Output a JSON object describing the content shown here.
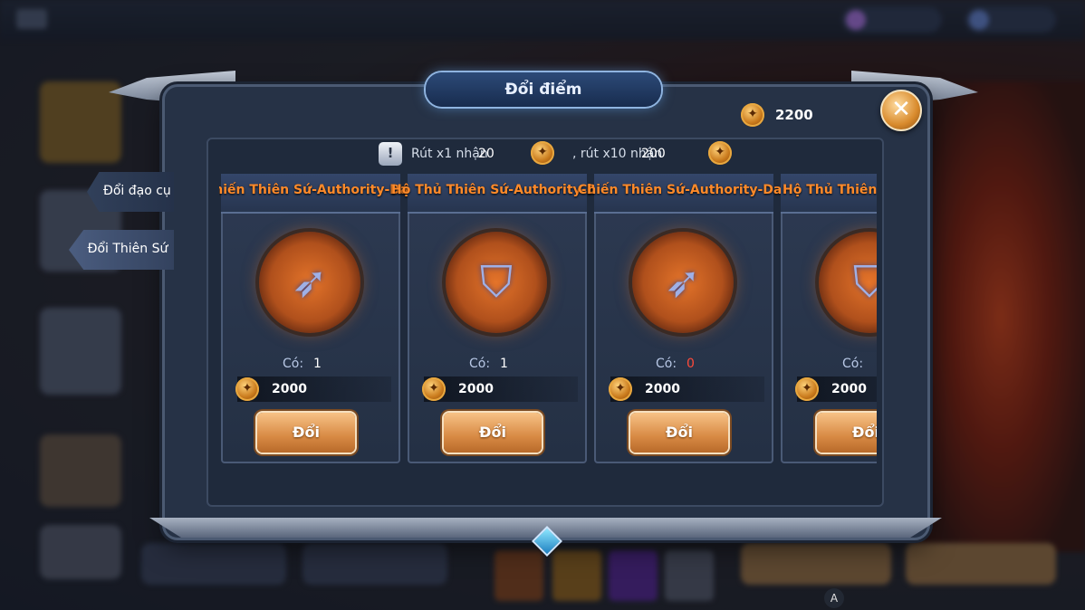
{
  "dialog": {
    "title": "Đổi điểm",
    "balance": "2200",
    "close_icon": "close-icon"
  },
  "tabs": [
    {
      "label": "Đổi đạo cụ"
    },
    {
      "label": "Đổi Thiên Sứ"
    }
  ],
  "info": {
    "draw_x1_label": "Rút x1 nhận",
    "draw_x1_value": "20",
    "draw_x10_label": ", rút x10 nhận",
    "draw_x10_value": "200"
  },
  "cards": [
    {
      "name": "Chiến Thiên Sứ-Authority-Dark Knight",
      "have_label": "Có:",
      "have": "1",
      "price": "2000",
      "button": "Đổi",
      "icon": "crossbow-icon"
    },
    {
      "name": "Hộ Thủ Thiên Sứ-Authority-Dark Knight",
      "have_label": "Có:",
      "have": "1",
      "price": "2000",
      "button": "Đổi",
      "icon": "shield-icon"
    },
    {
      "name": "Chiến Thiên Sứ-Authority-Dark Wizard",
      "have_label": "Có:",
      "have": "0",
      "price": "2000",
      "button": "Đổi",
      "icon": "crossbow-icon"
    },
    {
      "name": "Hộ Thủ Thiên Sứ-Authority",
      "have_label": "Có:",
      "have": "",
      "price": "2000",
      "button": "Đổi",
      "icon": "shield-icon"
    }
  ],
  "colors": {
    "card_name": "#ff8a2a",
    "zero_count": "#ff4a3a",
    "button": "#d88a44"
  },
  "bottom_hint": "A"
}
